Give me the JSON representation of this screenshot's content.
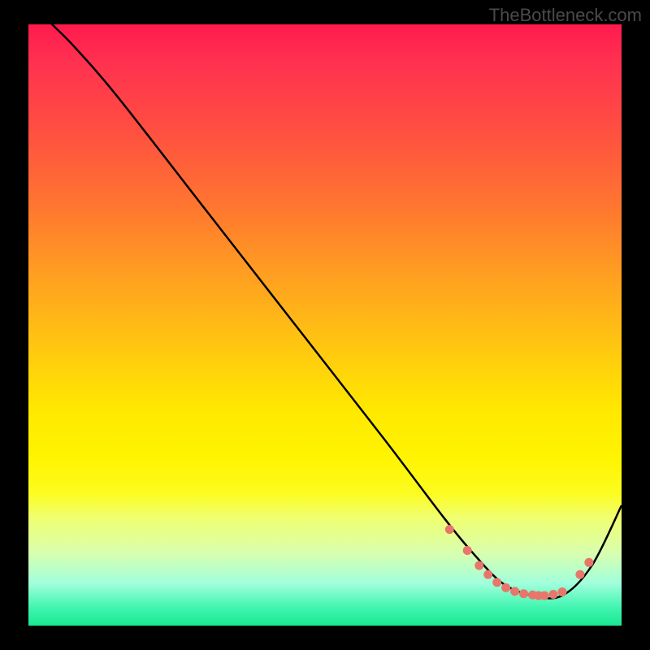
{
  "watermark": "TheBottleneck.com",
  "chart_data": {
    "type": "line",
    "title": "",
    "xlabel": "",
    "ylabel": "",
    "xlim": [
      0,
      100
    ],
    "ylim": [
      0,
      100
    ],
    "series": [
      {
        "name": "curve",
        "x": [
          0,
          4,
          8,
          15,
          30,
          45,
          60,
          70,
          75,
          80,
          85,
          90,
          95,
          100
        ],
        "y": [
          104,
          100,
          96,
          88,
          69,
          50,
          31,
          18,
          12,
          7,
          5,
          5,
          10,
          20
        ]
      }
    ],
    "markers": {
      "name": "fit-dots",
      "color": "#e8766a",
      "x": [
        71,
        74,
        76,
        77.5,
        79,
        80.5,
        82,
        83.5,
        85,
        86,
        87,
        88.5,
        90,
        93,
        94.5
      ],
      "y": [
        16,
        12.5,
        10,
        8.5,
        7.2,
        6.3,
        5.7,
        5.3,
        5.1,
        5.0,
        5.0,
        5.2,
        5.6,
        8.5,
        10.5
      ]
    },
    "gradient_stops": [
      {
        "pos": 0,
        "color": "#ff1a4d"
      },
      {
        "pos": 50,
        "color": "#ffc010"
      },
      {
        "pos": 75,
        "color": "#fff800"
      },
      {
        "pos": 100,
        "color": "#1ae890"
      }
    ]
  }
}
